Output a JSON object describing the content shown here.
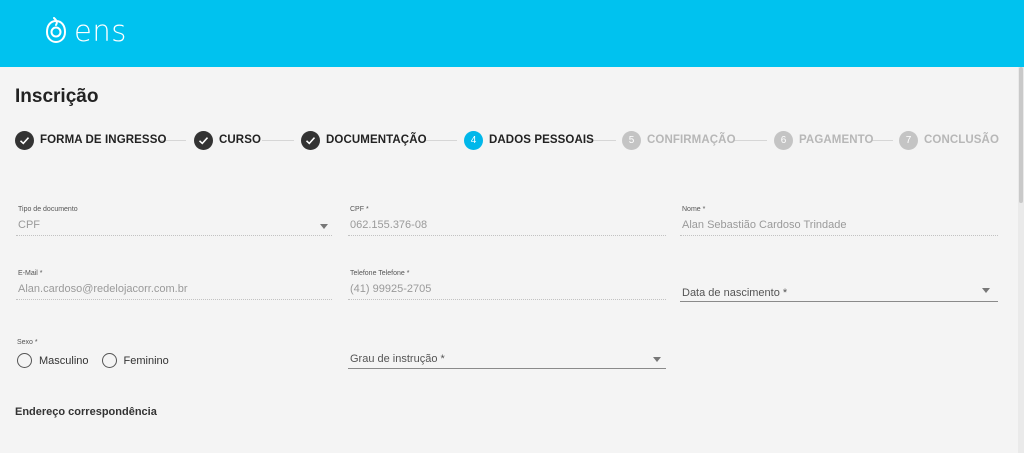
{
  "brand": {
    "name": "ens",
    "color": "#00c2ef",
    "icon": "ens-logo-icon"
  },
  "page": {
    "title": "Inscrição"
  },
  "steps": [
    {
      "number": "1",
      "label": "FORMA DE INGRESSO",
      "status": "done"
    },
    {
      "number": "2",
      "label": "CURSO",
      "status": "done"
    },
    {
      "number": "3",
      "label": "DOCUMENTAÇÃO",
      "status": "done"
    },
    {
      "number": "4",
      "label": "DADOS PESSOAIS",
      "status": "active"
    },
    {
      "number": "5",
      "label": "CONFIRMAÇÃO",
      "status": "pending"
    },
    {
      "number": "6",
      "label": "PAGAMENTO",
      "status": "pending"
    },
    {
      "number": "7",
      "label": "CONCLUSÃO",
      "status": "pending"
    }
  ],
  "form": {
    "tipo_documento": {
      "label": "Tipo de documento",
      "value": "CPF"
    },
    "cpf": {
      "label": "CPF *",
      "value": "062.155.376-08"
    },
    "nome": {
      "label": "Nome *",
      "value": "Alan Sebastião Cardoso Trindade"
    },
    "email": {
      "label": "E-Mail *",
      "value": "Alan.cardoso@redelojacorr.com.br"
    },
    "telefone": {
      "label": "Telefone Telefone *",
      "value": "(41) 99925-2705"
    },
    "data_nascimento": {
      "placeholder": "Data de nascimento *"
    },
    "sexo": {
      "label": "Sexo *",
      "options": [
        "Masculino",
        "Feminino"
      ]
    },
    "grau_instrucao": {
      "placeholder": "Grau de instrução *"
    }
  },
  "sections": {
    "endereco": "Endereço correspondência"
  },
  "colors": {
    "active_step": "#00b7ea",
    "done_step": "#333333",
    "pending_step": "#c4c4c4"
  }
}
